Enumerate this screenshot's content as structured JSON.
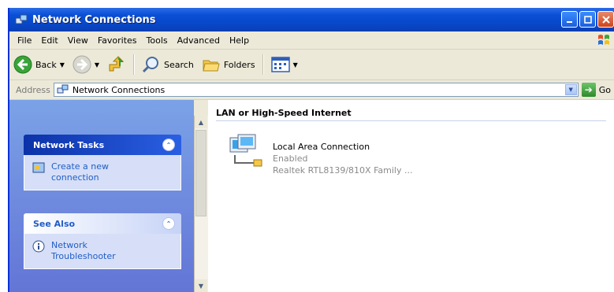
{
  "window": {
    "title": "Network Connections"
  },
  "menu": [
    "File",
    "Edit",
    "View",
    "Favorites",
    "Tools",
    "Advanced",
    "Help"
  ],
  "toolbar": {
    "back": "Back",
    "search": "Search",
    "folders": "Folders"
  },
  "address": {
    "label": "Address",
    "value": "Network Connections",
    "go": "Go"
  },
  "taskpane": {
    "network_tasks": {
      "title": "Network Tasks",
      "items": [
        "Create a new connection"
      ]
    },
    "see_also": {
      "title": "See Also",
      "items": [
        "Network Troubleshooter"
      ]
    }
  },
  "content": {
    "group": "LAN or High-Speed Internet",
    "connection": {
      "name": "Local Area Connection",
      "status": "Enabled",
      "device": "Realtek RTL8139/810X Family ..."
    }
  },
  "colors": {
    "title_bar": "#0a4fd6",
    "task_pane": "#7ba2e7",
    "link": "#215dc6"
  }
}
